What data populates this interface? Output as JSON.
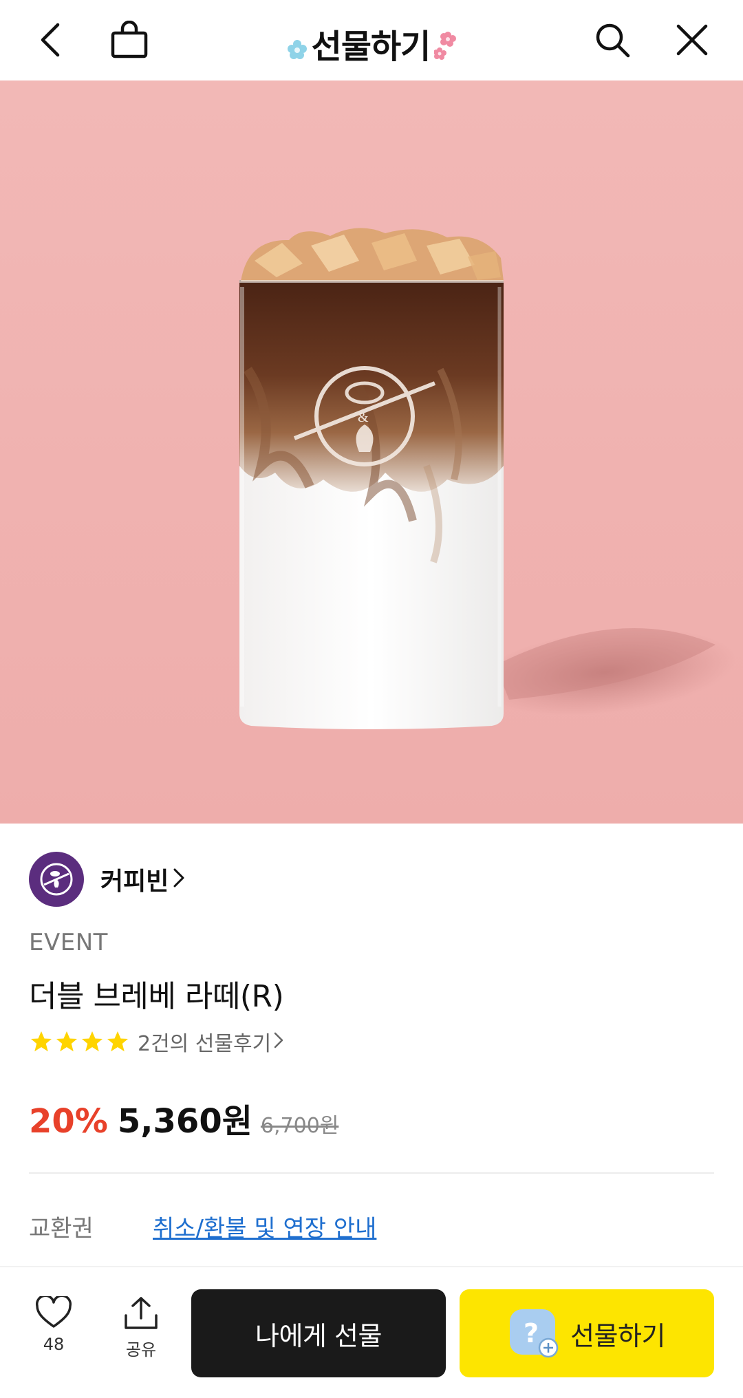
{
  "header": {
    "title": "선물하기",
    "icons": [
      "back-arrow-icon",
      "shopping-bag-icon",
      "search-icon",
      "close-icon"
    ]
  },
  "product": {
    "brand": "커피빈",
    "tag": "EVENT",
    "name": "더블 브레베 라떼(R)",
    "rating_stars": 4,
    "review_text": "2건의 선물후기",
    "discount": "20%",
    "price": "5,360원",
    "original_price": "6,700원",
    "cup_logo_text": "&"
  },
  "exchange": {
    "label": "교환권",
    "link": "취소/환불 및 연장 안내"
  },
  "bottom_bar": {
    "like_count": "48",
    "share_label": "공유",
    "self_gift_label": "나에게 선물",
    "gift_label": "선물하기",
    "gift_icon_glyph": "?"
  },
  "colors": {
    "accent_red": "#e8412a",
    "gift_yellow": "#fde500",
    "brand_purple": "#5b2d7e",
    "hero_pink": "#f1b7b5",
    "link_blue": "#1f6fcf"
  }
}
